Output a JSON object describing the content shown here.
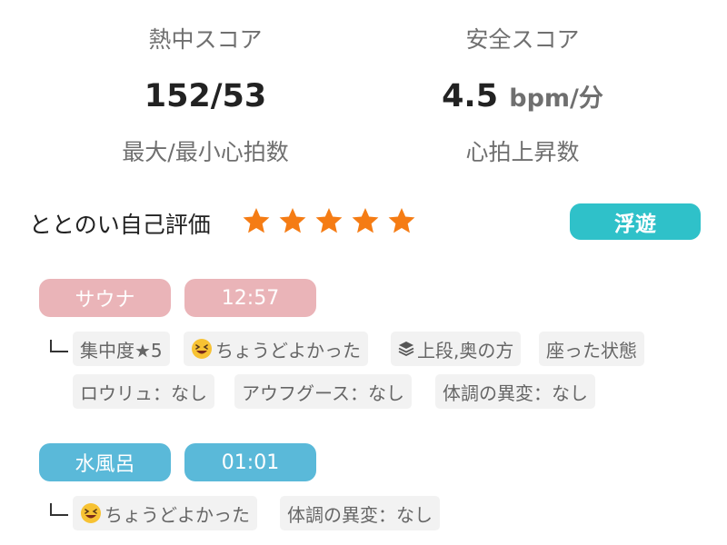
{
  "scores": {
    "focus_label": "熱中スコア",
    "safety_label": "安全スコア",
    "heart_rate_value": "152/53",
    "heart_rate_label": "最大/最小心拍数",
    "rise_value": "4.5",
    "rise_unit": "bpm/分",
    "rise_label": "心拍上昇数"
  },
  "rating": {
    "label": "ととのい自己評価",
    "stars": 5,
    "star_color": "#f57c14",
    "mood": "浮遊",
    "mood_color": "#2fc1c9"
  },
  "sessions": [
    {
      "type": "サウナ",
      "time": "12:57",
      "color": "#eab4b8",
      "tags": [
        {
          "text": "集中度★5"
        },
        {
          "icon": "grinning-face-icon",
          "text": "ちょうどよかった"
        },
        {
          "icon": "layers-icon",
          "text": "上段,奥の方"
        },
        {
          "text": "座った状態"
        },
        {
          "text": "ロウリュ：なし"
        },
        {
          "text": "アウフグース：なし"
        },
        {
          "text": "体調の異変：なし"
        }
      ]
    },
    {
      "type": "水風呂",
      "time": "01:01",
      "color": "#5ab9d9",
      "tags": [
        {
          "icon": "grinning-face-icon",
          "text": "ちょうどよかった"
        },
        {
          "text": "体調の異変：なし"
        }
      ]
    }
  ]
}
